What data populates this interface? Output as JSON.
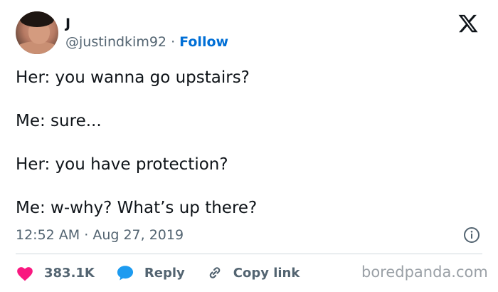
{
  "author": {
    "name": "J",
    "handle": "@justindkim92",
    "separator": "·",
    "follow_label": "Follow"
  },
  "tweet": {
    "lines": [
      "Her: you wanna go upstairs?",
      "Me: sure...",
      "Her: you have protection?",
      "Me: w-why? What’s up there?"
    ]
  },
  "meta": {
    "time": "12:52 AM",
    "separator": "·",
    "date": "Aug 27, 2019"
  },
  "actions": {
    "likes": "383.1K",
    "reply_label": "Reply",
    "copy_link_label": "Copy link"
  },
  "watermark": "boredpanda.com",
  "icons": {
    "brand": "x-logo-icon",
    "info": "info-icon",
    "like": "heart-icon",
    "reply": "speech-bubble-icon",
    "link": "link-icon"
  },
  "colors": {
    "text": "#0f1419",
    "secondary": "#536471",
    "follow": "#006fd6",
    "like": "#f91880",
    "reply": "#1d9bf0"
  }
}
